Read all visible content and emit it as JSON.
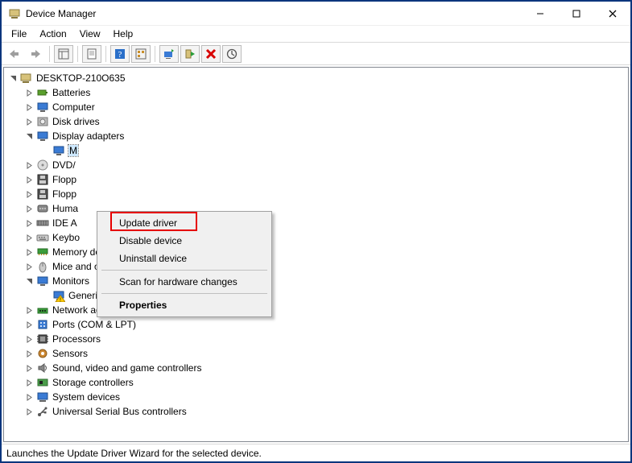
{
  "titlebar": {
    "title": "Device Manager"
  },
  "menubar": {
    "items": [
      "File",
      "Action",
      "View",
      "Help"
    ]
  },
  "tree": {
    "root": "DESKTOP-210O635",
    "categories": [
      {
        "label": "Batteries",
        "icon": "battery"
      },
      {
        "label": "Computer",
        "icon": "monitor"
      },
      {
        "label": "Disk drives",
        "icon": "disk"
      },
      {
        "label": "Display adapters",
        "icon": "monitor",
        "expanded": true,
        "children": [
          {
            "label": "M",
            "icon": "monitor",
            "selected": true
          }
        ]
      },
      {
        "label": "DVD/",
        "icon": "disc"
      },
      {
        "label": "Flopp",
        "icon": "floppy"
      },
      {
        "label": "Flopp",
        "icon": "floppy"
      },
      {
        "label": "Huma",
        "icon": "hid"
      },
      {
        "label": "IDE A",
        "icon": "ide"
      },
      {
        "label": "Keybo",
        "icon": "keyboard"
      },
      {
        "label": "Memory devices",
        "icon": "memory"
      },
      {
        "label": "Mice and other pointing devices",
        "icon": "mouse"
      },
      {
        "label": "Monitors",
        "icon": "monitor",
        "expanded": true,
        "children": [
          {
            "label": "Generic Non-PnP Monitor",
            "icon": "monitor-warn"
          }
        ]
      },
      {
        "label": "Network adapters",
        "icon": "network"
      },
      {
        "label": "Ports (COM & LPT)",
        "icon": "port"
      },
      {
        "label": "Processors",
        "icon": "cpu"
      },
      {
        "label": "Sensors",
        "icon": "sensor"
      },
      {
        "label": "Sound, video and game controllers",
        "icon": "sound"
      },
      {
        "label": "Storage controllers",
        "icon": "storage"
      },
      {
        "label": "System devices",
        "icon": "system"
      },
      {
        "label": "Universal Serial Bus controllers",
        "icon": "usb"
      }
    ]
  },
  "context_menu": {
    "items": [
      {
        "label": "Update driver",
        "highlighted": true
      },
      {
        "label": "Disable device"
      },
      {
        "label": "Uninstall device"
      },
      {
        "sep": true
      },
      {
        "label": "Scan for hardware changes"
      },
      {
        "sep": true
      },
      {
        "label": "Properties",
        "bold": true
      }
    ]
  },
  "statusbar": {
    "text": "Launches the Update Driver Wizard for the selected device."
  }
}
